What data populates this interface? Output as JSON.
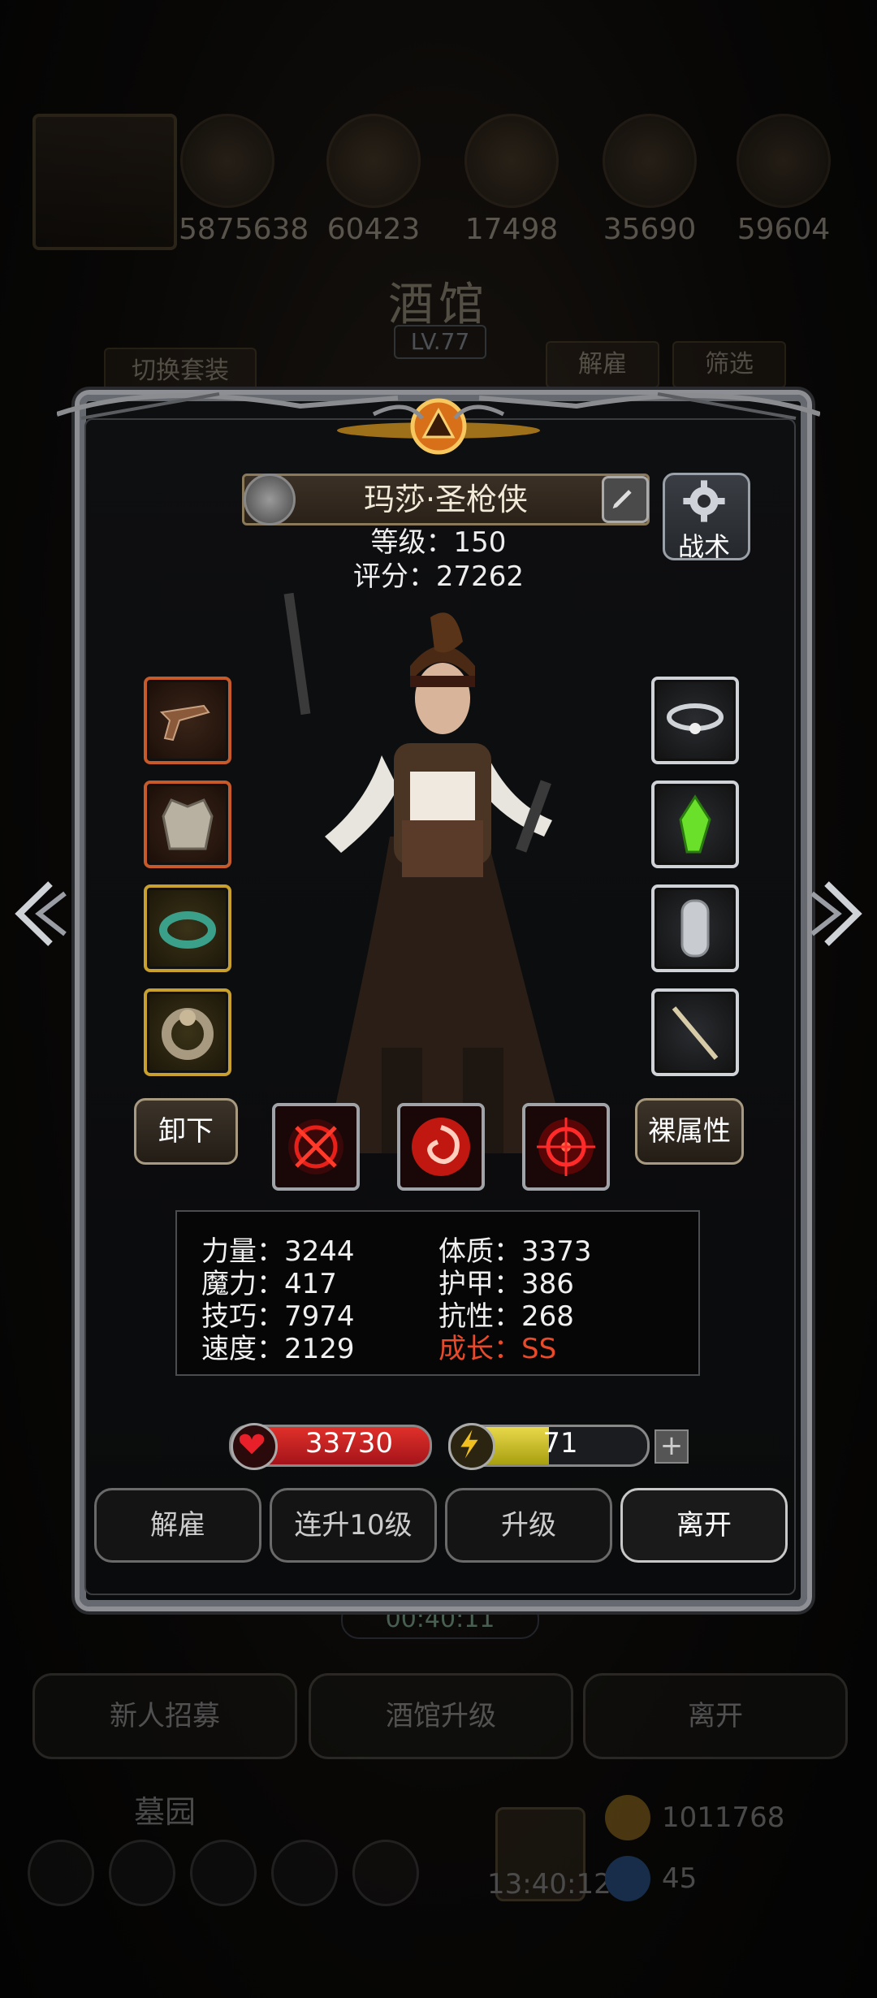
{
  "background": {
    "resources": [
      "5875638",
      "60423",
      "17498",
      "35690",
      "59604"
    ],
    "tavern_title": "酒馆",
    "tavern_level": "LV.77",
    "switch_outfit": "切换套装",
    "dismiss": "解雇",
    "filter": "筛选",
    "timer": "00:40:11",
    "bottom_buttons": [
      "新人招募",
      "酒馆升级",
      "离开"
    ],
    "tomb_label": "墓园",
    "gift_timer": "13:40:12",
    "coins": "1011768",
    "gems": "45"
  },
  "hero": {
    "name": "玛莎·圣枪侠",
    "level_line": "等级：150",
    "score_line": "评分：27262",
    "tactic_label": "战术"
  },
  "actions": {
    "unequip": "卸下",
    "base_attr": "裸属性"
  },
  "stats": [
    {
      "label": "力量：3244"
    },
    {
      "label": "体质：3373"
    },
    {
      "label": "魔力：417"
    },
    {
      "label": "护甲：386"
    },
    {
      "label": "技巧：7974"
    },
    {
      "label": "抗性：268"
    },
    {
      "label": "速度：2129"
    },
    {
      "label": "成长：SS"
    }
  ],
  "hp": "33730",
  "energy": "71",
  "energy_fill_fraction": 0.5,
  "plus": "+",
  "panel_buttons": [
    "解雇",
    "连升10级",
    "升级",
    "离开"
  ]
}
